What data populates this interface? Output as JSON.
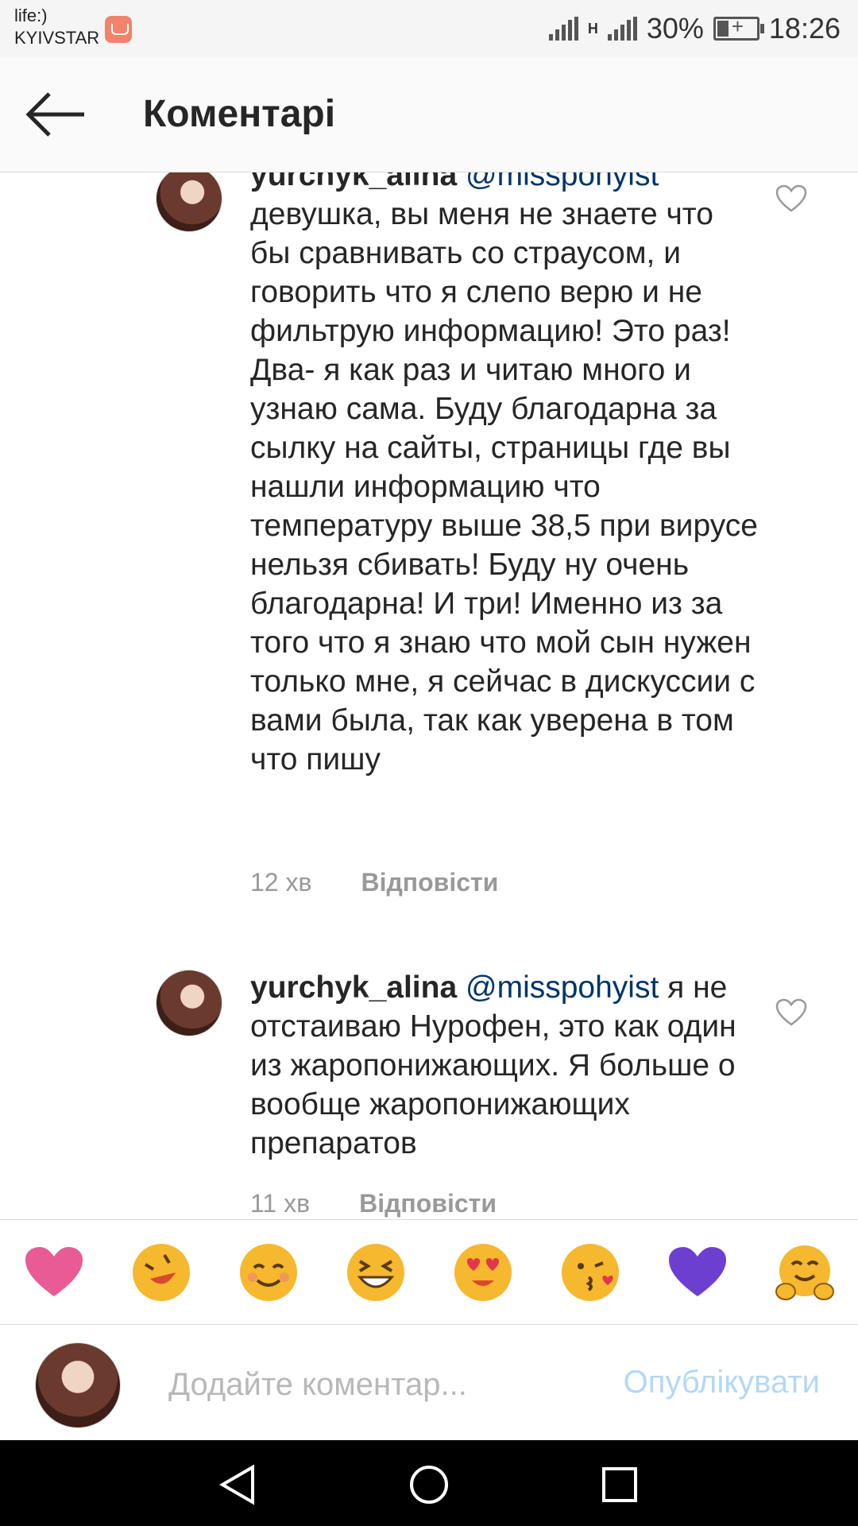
{
  "status_bar": {
    "carrier_line1": "life:)",
    "carrier_line2": "KYIVSTAR",
    "network_label": "H",
    "battery": "30%",
    "time": "18:26"
  },
  "header": {
    "title": "Коментарі"
  },
  "comments": [
    {
      "username": "yurchyk_alina",
      "mention": "@misspohyist",
      "text": "девушка, вы меня не знаете что бы сравнивать со страусом, и говорить что я слепо верю и не фильтрую информацию! Это раз! Два- я как раз и читаю много и узнаю сама. Буду благодарна за сылку на сайты, страницы где вы нашли информацию что температуру выше 38,5 при вирусе нельзя сбивать! Буду ну очень благодарна! И три! Именно из за того что я знаю что мой сын нужен только мне, я сейчас в дискуссии с вами была, так как уверена в том что пишу",
      "time": "12 хв",
      "reply_label": "Відповісти"
    },
    {
      "username": "yurchyk_alina",
      "mention": "@misspohyist",
      "text": "я не отстаиваю Нурофен, это как один из жаропонижающих. Я больше о вообще жаропонижающих препаратов",
      "time": "11 хв",
      "reply_label": "Відповісти"
    }
  ],
  "emoji_bar": [
    "pink-heart",
    "rolling-laughing-face",
    "smiling-face",
    "grinning-squinting-face",
    "heart-eyes-face",
    "kissing-face",
    "purple-heart",
    "hugging-face"
  ],
  "input": {
    "placeholder": "Додайте коментар...",
    "publish_label": "Опублікувати"
  },
  "colors": {
    "mention": "#003569",
    "publish_disabled": "#b3d8f7",
    "meta": "#999999"
  }
}
